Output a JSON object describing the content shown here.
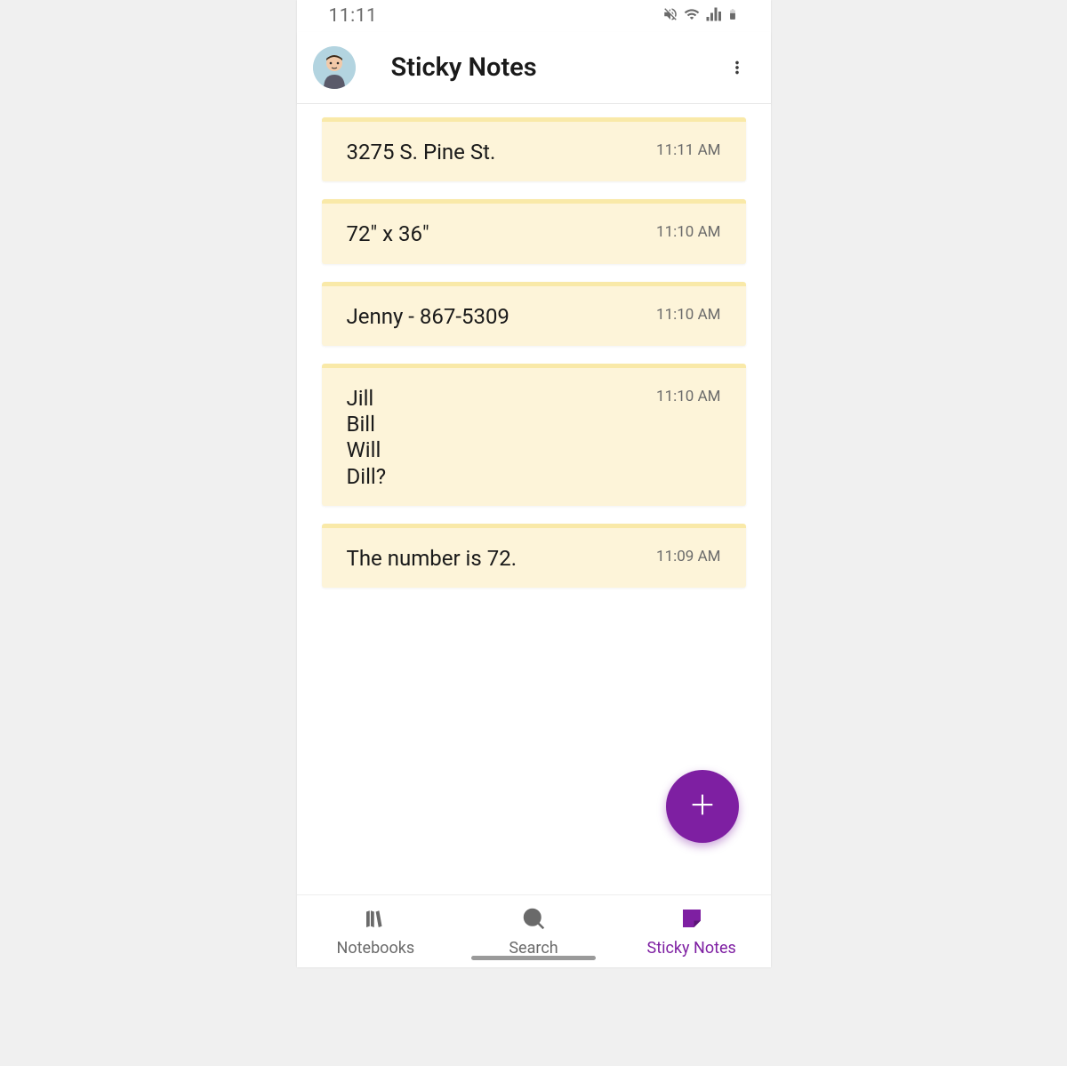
{
  "status_bar": {
    "time": "11:11"
  },
  "header": {
    "title": "Sticky Notes"
  },
  "notes": [
    {
      "content": "3275 S. Pine St.",
      "time": "11:11 AM"
    },
    {
      "content": "72\" x 36\"",
      "time": "11:10 AM"
    },
    {
      "content": "Jenny - 867-5309",
      "time": "11:10 AM"
    },
    {
      "content": "Jill\nBill\nWill\nDill?",
      "time": "11:10 AM"
    },
    {
      "content": "The number is 72.",
      "time": "11:09 AM"
    }
  ],
  "bottom_nav": {
    "items": [
      {
        "label": "Notebooks",
        "icon": "notebooks-icon",
        "active": false
      },
      {
        "label": "Search",
        "icon": "search-icon",
        "active": false
      },
      {
        "label": "Sticky Notes",
        "icon": "sticky-notes-icon",
        "active": true
      }
    ]
  },
  "colors": {
    "accent": "#7e1fa2",
    "note_bg": "#fdf4d9",
    "note_accent": "#f9e9a8"
  }
}
